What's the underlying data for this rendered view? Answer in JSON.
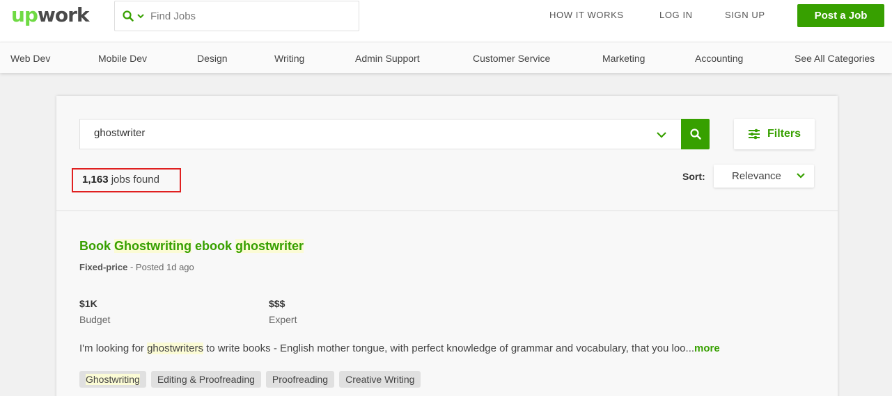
{
  "header": {
    "logo_up": "up",
    "logo_work": "work",
    "find_placeholder": "Find Jobs",
    "nav": [
      {
        "label": "HOW IT WORKS"
      },
      {
        "label": "LOG IN"
      },
      {
        "label": "SIGN UP"
      }
    ],
    "post_job_label": "Post a Job"
  },
  "categories": [
    {
      "label": "Web Dev"
    },
    {
      "label": "Mobile Dev"
    },
    {
      "label": "Design"
    },
    {
      "label": "Writing"
    },
    {
      "label": "Admin Support"
    },
    {
      "label": "Customer Service"
    },
    {
      "label": "Marketing"
    },
    {
      "label": "Accounting"
    },
    {
      "label": "See All Categories"
    }
  ],
  "search": {
    "query": "ghostwriter",
    "filters_label": "Filters"
  },
  "results": {
    "count": "1,163",
    "count_suffix": "jobs found",
    "sort_label": "Sort:",
    "sort_value": "Relevance"
  },
  "job": {
    "title_parts": [
      "Book ",
      "Ghostwriting",
      " ebook ",
      "ghostwriter"
    ],
    "type": "Fixed-price",
    "posted": " - Posted 1d ago",
    "budget_value": "$1K",
    "budget_label": "Budget",
    "level_value": "$$$",
    "level_label": "Expert",
    "desc_before": "I'm looking for ",
    "desc_highlight": "ghostwriters",
    "desc_after": " to write books - English mother tongue, with perfect knowledge of grammar and vocabulary, that you loo...",
    "more_label": "more",
    "tags": [
      "Ghostwriting",
      "Editing & Proofreading",
      "Proofreading",
      "Creative Writing"
    ]
  },
  "colors": {
    "brand_green": "#37a000",
    "logo_green": "#6fda44",
    "highlight": "#fbfbd5",
    "annotation_red": "#e02020"
  }
}
